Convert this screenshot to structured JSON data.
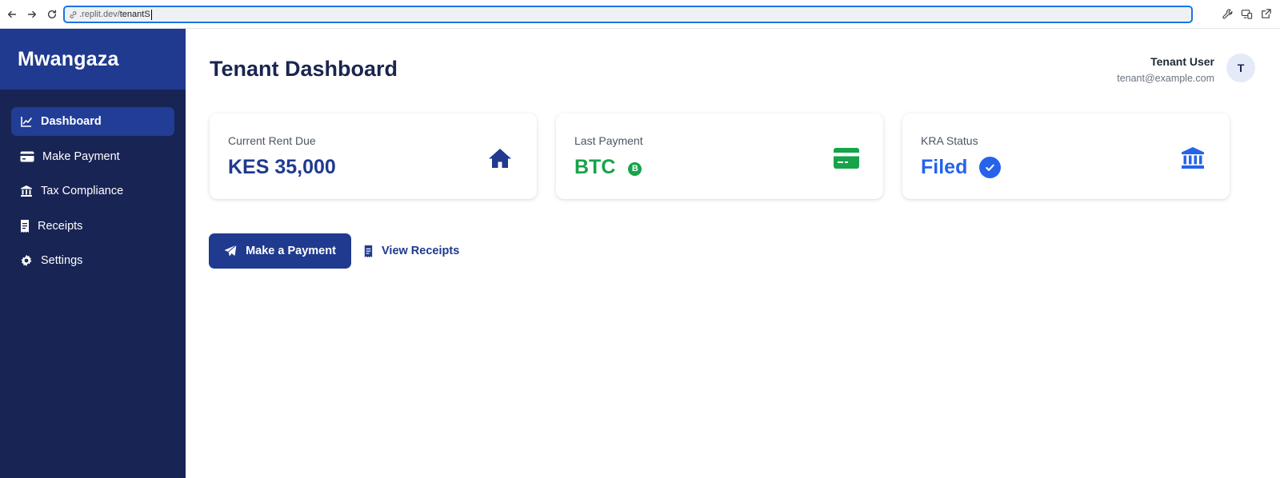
{
  "browser": {
    "url_host": ".replit.dev/",
    "url_path": "tenantS"
  },
  "sidebar": {
    "brand": "Mwangaza",
    "items": [
      {
        "label": "Dashboard",
        "icon": "chart-line-icon",
        "active": true
      },
      {
        "label": "Make Payment",
        "icon": "credit-card-icon",
        "active": false
      },
      {
        "label": "Tax Compliance",
        "icon": "bank-icon",
        "active": false
      },
      {
        "label": "Receipts",
        "icon": "receipt-icon",
        "active": false
      },
      {
        "label": "Settings",
        "icon": "gear-icon",
        "active": false
      }
    ]
  },
  "header": {
    "title": "Tenant Dashboard",
    "user_name": "Tenant User",
    "user_email": "tenant@example.com",
    "avatar_initial": "T"
  },
  "cards": [
    {
      "label": "Current Rent Due",
      "value": "KES 35,000",
      "icon": "home-icon",
      "color": "#1f3a8f"
    },
    {
      "label": "Last Payment",
      "value": "BTC",
      "badge": "B",
      "badge_icon": "bitcoin-icon",
      "icon": "credit-card-icon",
      "color": "#16a34a"
    },
    {
      "label": "KRA Status",
      "value": "Filed",
      "badge_icon": "check-circle-icon",
      "icon": "bank-icon",
      "color": "#2563eb"
    }
  ],
  "actions": {
    "primary_label": "Make a Payment",
    "primary_icon": "paper-plane-icon",
    "secondary_label": "View Receipts",
    "secondary_icon": "receipt-icon"
  },
  "colors": {
    "sidebar_bg": "#182454",
    "brand_bg": "#1f3a8f",
    "accent": "#1f3a8f",
    "success": "#16a34a",
    "info": "#2563eb"
  }
}
